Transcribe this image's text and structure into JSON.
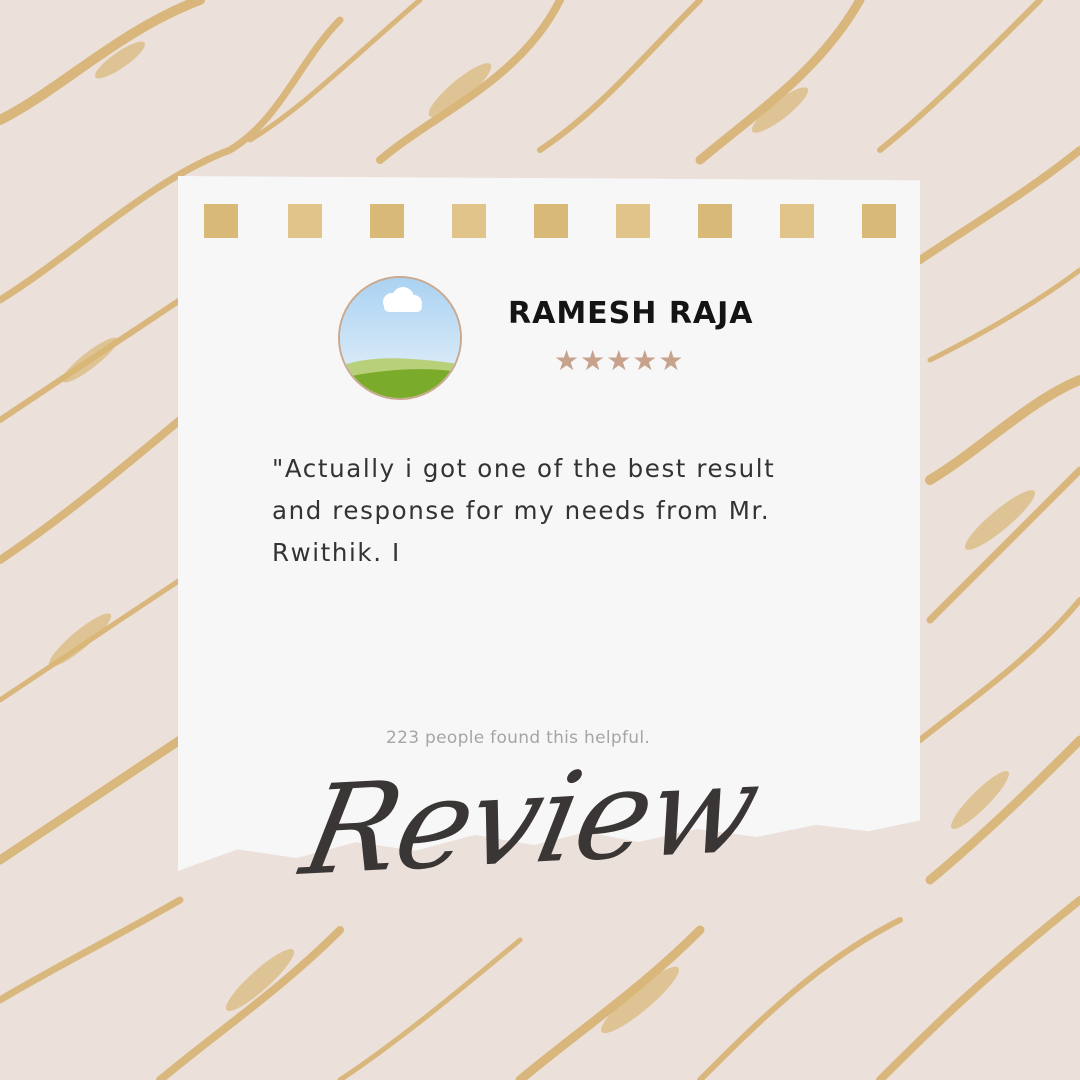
{
  "colors": {
    "background": "#ece0da",
    "gold": "#d6b06c",
    "card": "#f7f7f7",
    "star": "#c7a28d",
    "title": "#3b3636"
  },
  "review": {
    "reviewer_name": "RAMESH RAJA",
    "stars_display": "★★★★★",
    "rating": 5,
    "rating_max": 5,
    "quote": "\"Actually i got one of the best result and response for my needs from Mr. Rwithik. I",
    "helpful_text": "223 people found this helpful.",
    "title": "Review"
  },
  "icons": {
    "avatar": "landscape-avatar-icon"
  }
}
